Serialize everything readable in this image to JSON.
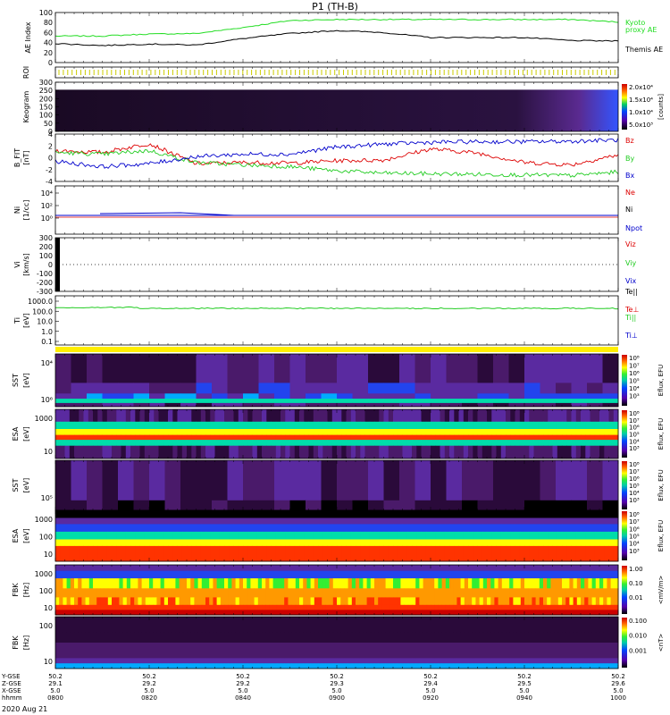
{
  "title": "P1 (TH-B)",
  "date_label": "2020 Aug 21",
  "colors": {
    "kyoto": "#22dd22",
    "themis": "#000000",
    "bz": "#dd0000",
    "by": "#22cc22",
    "bx": "#0000cc",
    "roi": "#cccc00",
    "bar": "#ffee00",
    "te": "#22cc22",
    "ni": "#0000cc",
    "ne": "#dd0000"
  },
  "chart_data": [
    {
      "type": "line",
      "panel": "AE Index",
      "ylabel": "AE Index",
      "ylim": [
        0,
        100
      ],
      "yticks": [
        "0",
        "20",
        "40",
        "60",
        "80",
        "100"
      ],
      "x": [
        "0800",
        "0810",
        "0820",
        "0830",
        "0840",
        "0850",
        "0900",
        "0910",
        "0920",
        "0930",
        "0940",
        "0950",
        "1000"
      ],
      "series": [
        {
          "name": "Kyoto proxy AE",
          "values": [
            53,
            53,
            57,
            58,
            70,
            84,
            86,
            86,
            86,
            86,
            86,
            86,
            81
          ]
        },
        {
          "name": "Themis AE",
          "values": [
            38,
            34,
            37,
            35,
            48,
            58,
            64,
            60,
            50,
            50,
            50,
            44,
            43
          ]
        }
      ],
      "legend": [
        "Kyoto",
        "proxy AE",
        "Themis AE"
      ]
    },
    {
      "type": "line",
      "panel": "ROI",
      "ylabel": "ROI"
    },
    {
      "type": "heatmap",
      "panel": "Keogram",
      "ylabel": "Keogram",
      "ylim": [
        0,
        300
      ],
      "yticks": [
        "0",
        "50",
        "100",
        "150",
        "200",
        "250",
        "300"
      ],
      "colorbar": {
        "label": "[counts]",
        "ticks": [
          "2.0x10⁴",
          "1.5x10⁴",
          "1.0x10⁴",
          "5.0x10³"
        ]
      }
    },
    {
      "type": "line",
      "panel": "B FIT",
      "ylabel": "B_FIT",
      "units": "[nT]",
      "ylim": [
        -4,
        4
      ],
      "yticks": [
        "-4",
        "-2",
        "0",
        "2",
        "4"
      ],
      "x": [
        "0800",
        "0810",
        "0820",
        "0830",
        "0840",
        "0850",
        "0900",
        "0910",
        "0920",
        "0930",
        "0940",
        "0950",
        "1000"
      ],
      "series": [
        {
          "name": "Bz",
          "values": [
            1.2,
            0.9,
            2.4,
            -1.0,
            -0.8,
            -0.9,
            -0.5,
            -0.4,
            1.5,
            0.8,
            -0.8,
            -1.2,
            0.5
          ]
        },
        {
          "name": "By",
          "values": [
            0.9,
            0.6,
            1.2,
            -0.8,
            -1.2,
            -1.5,
            -2.2,
            -2.6,
            -2.7,
            -2.8,
            -2.9,
            -3.0,
            -2.4
          ]
        },
        {
          "name": "Bx",
          "values": [
            -0.6,
            -1.5,
            -1.0,
            0.2,
            0.6,
            0.6,
            1.8,
            2.3,
            2.6,
            2.7,
            2.7,
            2.8,
            3.0
          ]
        }
      ],
      "legend": [
        "Bz",
        "By",
        "Bx"
      ]
    },
    {
      "type": "line",
      "panel": "Ni",
      "ylabel": "Ni",
      "units": "[1/cc]",
      "yticks": [
        "10⁴",
        "10²",
        "10⁰"
      ],
      "legend": [
        "Ne",
        "Ni",
        "Npot"
      ]
    },
    {
      "type": "line",
      "panel": "Vi",
      "ylabel": "Vi",
      "units": "[km/s]",
      "ylim": [
        -300,
        300
      ],
      "yticks": [
        "300",
        "200",
        "100",
        "0",
        "-100",
        "-200",
        "-300"
      ],
      "legend": [
        "Viz",
        "Viy",
        "Vix"
      ]
    },
    {
      "type": "line",
      "panel": "Ti",
      "ylabel": "Ti",
      "units": "[eV]",
      "yticks": [
        "1000.0",
        "100.0",
        "10.0",
        "1.0",
        "0.1"
      ],
      "legend": [
        "Te||",
        "Te⊥",
        "Ti||",
        "Ti⊥"
      ]
    },
    {
      "type": "heatmap",
      "panel": "SST ion",
      "ylabel": "SST",
      "units": "[eV]",
      "yticks": [
        "10⁴",
        "10⁶"
      ],
      "colorbar": {
        "label": "Eflux, EFU",
        "ticks": [
          "10⁸",
          "10⁷",
          "10⁶",
          "10⁵",
          "10⁴",
          "10³"
        ]
      }
    },
    {
      "type": "heatmap",
      "panel": "ESA ion",
      "ylabel": "ESA",
      "units": "[eV]",
      "yticks": [
        "1000",
        "10"
      ],
      "colorbar": {
        "label": "Eflux, EFU",
        "ticks": [
          "10⁸",
          "10⁷",
          "10⁶",
          "10⁵",
          "10⁴",
          "10³"
        ]
      }
    },
    {
      "type": "heatmap",
      "panel": "SST electron",
      "ylabel": "SST",
      "units": "[eV]",
      "yticks": [
        "10⁵"
      ],
      "colorbar": {
        "label": "Eflux, EFU",
        "ticks": [
          "10⁸",
          "10⁷",
          "10⁶",
          "10⁵",
          "10⁴",
          "10³"
        ]
      }
    },
    {
      "type": "heatmap",
      "panel": "ESA electron",
      "ylabel": "ESA",
      "units": "[eV]",
      "yticks": [
        "1000",
        "100",
        "10"
      ],
      "colorbar": {
        "label": "Eflux, EFU",
        "ticks": [
          "10⁸",
          "10⁷",
          "10⁶",
          "10⁵",
          "10⁴",
          "10³"
        ]
      }
    },
    {
      "type": "heatmap",
      "panel": "FBK E",
      "ylabel": "FBK",
      "units": "[Hz]",
      "yticks": [
        "1000",
        "100",
        "10"
      ],
      "colorbar": {
        "label": "<mV/m>",
        "ticks": [
          "1.00",
          "0.10",
          "0.01"
        ]
      }
    },
    {
      "type": "heatmap",
      "panel": "FBK B",
      "ylabel": "FBK",
      "units": "[Hz]",
      "yticks": [
        "100",
        "10"
      ],
      "colorbar": {
        "label": "<nT>",
        "ticks": [
          "0.100",
          "0.010",
          "0.001"
        ]
      }
    }
  ],
  "footer": {
    "row_labels": [
      "Y-GSE",
      "Z-GSE",
      "X-GSE",
      "hhmm"
    ],
    "columns": [
      [
        "50.2",
        "29.1",
        "5.0",
        "0800"
      ],
      [
        "50.2",
        "29.2",
        "5.0",
        "0820"
      ],
      [
        "50.2",
        "29.2",
        "5.0",
        "0840"
      ],
      [
        "50.2",
        "29.3",
        "5.0",
        "0900"
      ],
      [
        "50.2",
        "29.4",
        "5.0",
        "0920"
      ],
      [
        "50.2",
        "29.5",
        "5.0",
        "0940"
      ],
      [
        "50.2",
        "29.6",
        "5.0",
        "1000"
      ]
    ]
  }
}
